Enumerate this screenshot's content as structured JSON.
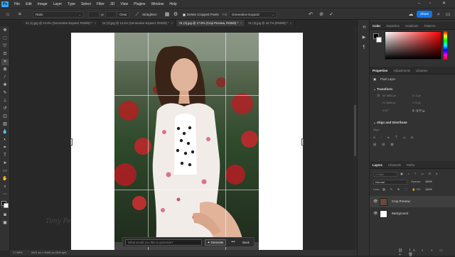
{
  "menu": [
    "File",
    "Edit",
    "Image",
    "Layer",
    "Type",
    "Select",
    "Filter",
    "3D",
    "View",
    "Plugins",
    "Window",
    "Help"
  ],
  "app_logo": "Ps",
  "options": {
    "ratio": "Ratio",
    "clear": "Clear",
    "straighten": "Straighten",
    "delete_cropped": "Delete Cropped Pixels",
    "fill_label": "Fill:",
    "fill_value": "Generative Expand",
    "share": "Share"
  },
  "tabs": [
    {
      "label": "01 (1).jpg @ 24.3% (Generative Expand, RGB/8) *",
      "active": false
    },
    {
      "label": "01 (3).jpg @ 10.4% (Generative Expand, RGB/8) *",
      "active": false
    },
    {
      "label": "01 (3).jpg @ 17.9% (Crop Preview, RGB/8) *",
      "active": true
    },
    {
      "label": "01 (4).jpg @ 18.7% (RGB/8) *",
      "active": false
    }
  ],
  "generate_bar": {
    "placeholder": "What would you like to generate?",
    "generate": "Generate",
    "more": "•••",
    "back": "Back"
  },
  "status": {
    "zoom": "17.89%",
    "doc_size": "5401 px x 5406 px (300 ppi)"
  },
  "color_panel": {
    "tabs": [
      "Color",
      "Swatches",
      "Gradients",
      "Patterns"
    ],
    "fg_color": "#000000",
    "bg_color": "#ffffff"
  },
  "properties_panel": {
    "tabs": [
      "Properties",
      "Adjustments",
      "Libraries"
    ],
    "layer_type": "Pixel Layer",
    "transform_title": "Transform",
    "w": "W: 3651 px",
    "h": "H: 5406 px",
    "x": "X: 0 px",
    "y": "Y: 0 px",
    "angle": "0.00°",
    "align_title": "Align and Distribute",
    "align_label": "Align:"
  },
  "layers_panel": {
    "tabs": [
      "Layers",
      "Channels",
      "Paths"
    ],
    "search_placeholder": "Kind",
    "blend_mode": "Normal",
    "opacity_label": "Opacity:",
    "opacity": "100%",
    "lock_label": "Lock:",
    "fill_label": "Fill:",
    "fill": "100%",
    "layers": [
      {
        "name": "Crop Preview",
        "selected": true
      },
      {
        "name": "Background",
        "selected": false
      }
    ]
  },
  "watermark": "Tony Ferraro"
}
